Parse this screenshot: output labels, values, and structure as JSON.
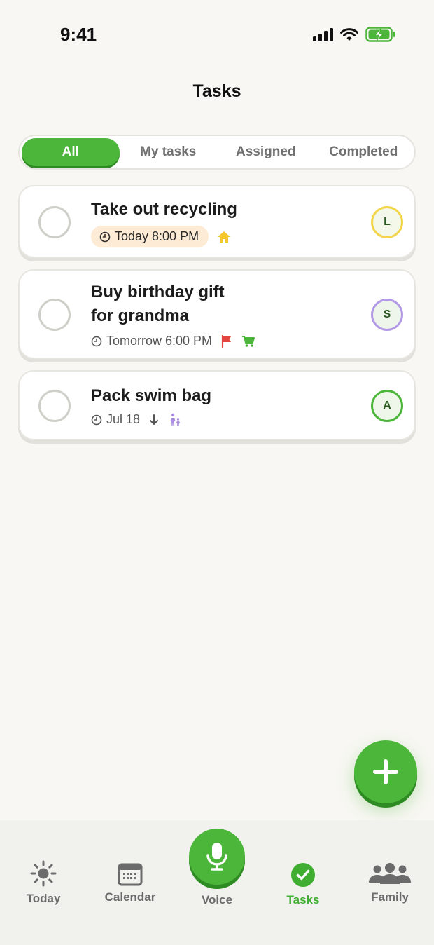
{
  "status_bar": {
    "time": "9:41"
  },
  "header": {
    "title": "Tasks"
  },
  "filters": [
    {
      "label": "All",
      "active": true
    },
    {
      "label": "My tasks",
      "active": false
    },
    {
      "label": "Assigned",
      "active": false
    },
    {
      "label": "Completed",
      "active": false
    }
  ],
  "tasks": [
    {
      "title_lines": [
        "Take out recycling"
      ],
      "due": "Today 8:00 PM",
      "category_icon": "home-icon",
      "avatar": "L"
    },
    {
      "title_lines": [
        "Buy birthday gift",
        "for grandma"
      ],
      "due": "Tomorrow 6:00 PM",
      "priority_icon": "flag-icon",
      "category_icon": "cart-icon",
      "avatar": "S"
    },
    {
      "title_lines": [
        "Pack swim bag"
      ],
      "due": "Jul 18",
      "priority_icon": "arrow-down-icon",
      "category_icon": "family-icon",
      "avatar": "A"
    }
  ],
  "tab_bar": {
    "today": "Today",
    "calendar": "Calendar",
    "voice": "Voice",
    "tasks": "Tasks",
    "family": "Family"
  },
  "colors": {
    "accent": "#4cb63a",
    "accent_dark": "#2e8b23",
    "background": "#f8f7f3",
    "pill": "#fdebd6",
    "avatar_l": "#f2d54b",
    "avatar_s": "#b39ae6",
    "flag": "#e2463f"
  }
}
